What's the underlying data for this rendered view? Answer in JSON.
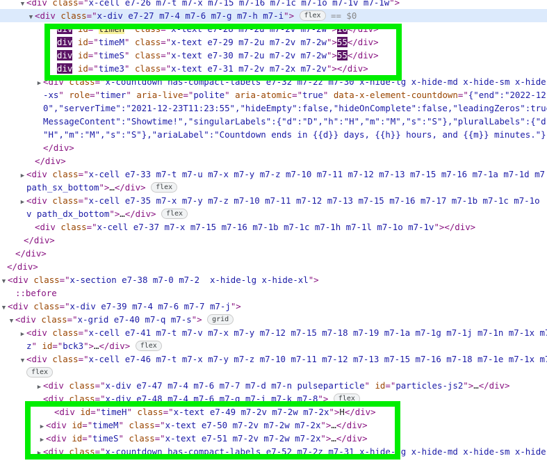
{
  "lines": [
    {
      "indent": 38,
      "tri": "down",
      "segments": [
        {
          "k": "tag",
          "t": "<div "
        },
        {
          "k": "an",
          "t": "class"
        },
        {
          "k": "tag",
          "t": "=\""
        },
        {
          "k": "av",
          "t": "x-cell e7-26 m7-t m7-x m7-15 m7-16 m7-1c m7-1o m7-1v m7-1w"
        },
        {
          "k": "tag",
          "t": "\">"
        }
      ]
    },
    {
      "indent": 50,
      "tri": "down",
      "sel": true,
      "segments": [
        {
          "k": "tag",
          "t": "<div "
        },
        {
          "k": "an",
          "t": "class"
        },
        {
          "k": "tag",
          "t": "=\""
        },
        {
          "k": "av",
          "t": "x-div e7-27 m7-4 m7-6 m7-g m7-h m7-i"
        },
        {
          "k": "tag",
          "t": "\">"
        },
        {
          "k": "sp",
          "t": " "
        },
        {
          "k": "badge",
          "t": "flex"
        },
        {
          "k": "eq",
          "t": " == $0"
        }
      ]
    },
    {
      "indent": 82,
      "segments": [
        {
          "k": "invtag",
          "t": "div"
        },
        {
          "k": "sp",
          "t": " "
        },
        {
          "k": "an",
          "t": "id"
        },
        {
          "k": "tag",
          "t": "=\""
        },
        {
          "k": "hlid",
          "t": "timeH"
        },
        {
          "k": "tag",
          "t": "\" "
        },
        {
          "k": "an",
          "t": "class"
        },
        {
          "k": "tag",
          "t": "=\""
        },
        {
          "k": "av",
          "t": "x-text e7-28 m7-2u m7-2v m7-2w"
        },
        {
          "k": "tag",
          "t": "\">"
        },
        {
          "k": "invval",
          "t": "16"
        },
        {
          "k": "tag",
          "t": "</div>"
        }
      ]
    },
    {
      "indent": 82,
      "segments": [
        {
          "k": "invtag",
          "t": "div"
        },
        {
          "k": "sp",
          "t": " "
        },
        {
          "k": "an",
          "t": "id"
        },
        {
          "k": "tag",
          "t": "=\""
        },
        {
          "k": "av",
          "t": "timeM"
        },
        {
          "k": "tag",
          "t": "\" "
        },
        {
          "k": "an",
          "t": "class"
        },
        {
          "k": "tag",
          "t": "=\""
        },
        {
          "k": "av",
          "t": "x-text e7-29 m7-2u m7-2v m7-2w"
        },
        {
          "k": "tag",
          "t": "\">"
        },
        {
          "k": "invval",
          "t": "55"
        },
        {
          "k": "tag",
          "t": "</div>"
        }
      ]
    },
    {
      "indent": 82,
      "segments": [
        {
          "k": "invtag",
          "t": "div"
        },
        {
          "k": "sp",
          "t": " "
        },
        {
          "k": "an",
          "t": "id"
        },
        {
          "k": "tag",
          "t": "=\""
        },
        {
          "k": "av",
          "t": "timeS"
        },
        {
          "k": "tag",
          "t": "\" "
        },
        {
          "k": "an",
          "t": "class"
        },
        {
          "k": "tag",
          "t": "=\""
        },
        {
          "k": "av",
          "t": "x-text e7-30 m7-2u m7-2v m7-2w"
        },
        {
          "k": "tag",
          "t": "\">"
        },
        {
          "k": "invval",
          "t": "55"
        },
        {
          "k": "tag",
          "t": "</div>"
        }
      ]
    },
    {
      "indent": 82,
      "segments": [
        {
          "k": "invtag",
          "t": "div"
        },
        {
          "k": "sp",
          "t": " "
        },
        {
          "k": "an",
          "t": "id"
        },
        {
          "k": "tag",
          "t": "=\""
        },
        {
          "k": "av",
          "t": "time3"
        },
        {
          "k": "tag",
          "t": "\" "
        },
        {
          "k": "an",
          "t": "class"
        },
        {
          "k": "tag",
          "t": "=\""
        },
        {
          "k": "av",
          "t": "x-text e7-31 m7-2v m7-2x m7-2v"
        },
        {
          "k": "tag",
          "t": "\">"
        },
        {
          "k": "tag",
          "t": "</div>"
        }
      ]
    },
    {
      "indent": 62,
      "tri": "right",
      "segments": [
        {
          "k": "tag",
          "t": "<div "
        },
        {
          "k": "an",
          "t": "class"
        },
        {
          "k": "tag",
          "t": "=\""
        },
        {
          "k": "av",
          "t": "x-countdown has-compact-labels e7-32 m7-2z m7-30 x-hide-lg x-hide-md x-hide-sm x-hide"
        }
      ]
    },
    {
      "indent": 62,
      "segments": [
        {
          "k": "av",
          "t": "-xs"
        },
        {
          "k": "tag",
          "t": "\" "
        },
        {
          "k": "an",
          "t": "role"
        },
        {
          "k": "tag",
          "t": "=\""
        },
        {
          "k": "av",
          "t": "timer"
        },
        {
          "k": "tag",
          "t": "\" "
        },
        {
          "k": "an",
          "t": "aria-live"
        },
        {
          "k": "tag",
          "t": "=\""
        },
        {
          "k": "av",
          "t": "polite"
        },
        {
          "k": "tag",
          "t": "\" "
        },
        {
          "k": "an",
          "t": "aria-atomic"
        },
        {
          "k": "tag",
          "t": "=\""
        },
        {
          "k": "av",
          "t": "true"
        },
        {
          "k": "tag",
          "t": "\" "
        },
        {
          "k": "an",
          "t": "data-x-element-countdown"
        },
        {
          "k": "tag",
          "t": "=\""
        },
        {
          "k": "av",
          "t": "{\"end\":\"2022-12-"
        }
      ]
    },
    {
      "indent": 62,
      "segments": [
        {
          "k": "av",
          "t": "0\",\"serverTime\":\"2021-12-23T11:23:55\",\"hideEmpty\":false,\"hideOnComplete\":false,\"leadingZeros\":true"
        }
      ]
    },
    {
      "indent": 62,
      "segments": [
        {
          "k": "av",
          "t": "MessageContent\":\"Showtime!\",\"singularLabels\":{\"d\":\"D\",\"h\":\"H\",\"m\":\"M\",\"s\":\"S\"},\"pluralLabels\":{\"d\""
        }
      ]
    },
    {
      "indent": 62,
      "segments": [
        {
          "k": "av",
          "t": "\"H\",\"m\":\"M\",\"s\":\"S\"},\"ariaLabel\":\"Countdown ends in {{d}} days, {{h}} hours, and {{m}} minutes.\"}"
        }
      ]
    },
    {
      "indent": 62,
      "segments": [
        {
          "k": "tag",
          "t": "</div>"
        }
      ]
    },
    {
      "indent": 50,
      "segments": [
        {
          "k": "tag",
          "t": "</div>"
        }
      ]
    },
    {
      "indent": 38,
      "tri": "right",
      "segments": [
        {
          "k": "tag",
          "t": "<div "
        },
        {
          "k": "an",
          "t": "class"
        },
        {
          "k": "tag",
          "t": "=\""
        },
        {
          "k": "av",
          "t": "x-cell e7-33 m7-t m7-u m7-x m7-y m7-z m7-10 m7-11 m7-12 m7-13 m7-15 m7-16 m7-1a m7-1d m7"
        }
      ]
    },
    {
      "indent": 38,
      "segments": [
        {
          "k": "av",
          "t": "path_sx_bottom"
        },
        {
          "k": "tag",
          "t": "\">"
        },
        {
          "k": "txt",
          "t": "…"
        },
        {
          "k": "tag",
          "t": "</div>"
        },
        {
          "k": "sp",
          "t": " "
        },
        {
          "k": "badge",
          "t": "flex"
        }
      ]
    },
    {
      "indent": 38,
      "tri": "right",
      "segments": [
        {
          "k": "tag",
          "t": "<div "
        },
        {
          "k": "an",
          "t": "class"
        },
        {
          "k": "tag",
          "t": "=\""
        },
        {
          "k": "av",
          "t": "x-cell e7-35 m7-x m7-y m7-z m7-10 m7-11 m7-12 m7-13 m7-15 m7-16 m7-17 m7-1b m7-1c m7-1o"
        }
      ]
    },
    {
      "indent": 38,
      "segments": [
        {
          "k": "av",
          "t": "v path_dx_bottom"
        },
        {
          "k": "tag",
          "t": "\">"
        },
        {
          "k": "txt",
          "t": "…"
        },
        {
          "k": "tag",
          "t": "</div>"
        },
        {
          "k": "sp",
          "t": " "
        },
        {
          "k": "badge",
          "t": "flex"
        }
      ]
    },
    {
      "indent": 50,
      "segments": [
        {
          "k": "tag",
          "t": "<div "
        },
        {
          "k": "an",
          "t": "class"
        },
        {
          "k": "tag",
          "t": "=\""
        },
        {
          "k": "av",
          "t": "x-cell e7-37 m7-x m7-15 m7-16 m7-1b m7-1c m7-1h m7-1l m7-1o m7-1v"
        },
        {
          "k": "tag",
          "t": "\"></div>"
        }
      ]
    },
    {
      "indent": 34,
      "segments": [
        {
          "k": "tag",
          "t": "</div>"
        }
      ]
    },
    {
      "indent": 22,
      "segments": [
        {
          "k": "tag",
          "t": "</div>"
        }
      ]
    },
    {
      "indent": 10,
      "segments": [
        {
          "k": "tag",
          "t": "</div>"
        }
      ]
    },
    {
      "indent": 4,
      "tri": "down",
      "segments": [
        {
          "k": "tag",
          "t": "<div "
        },
        {
          "k": "an",
          "t": "class"
        },
        {
          "k": "tag",
          "t": "=\""
        },
        {
          "k": "av",
          "t": "x-section e7-38 m7-0 m7-2  x-hide-lg x-hide-xl"
        },
        {
          "k": "tag",
          "t": "\">"
        }
      ]
    },
    {
      "indent": 22,
      "segments": [
        {
          "k": "pseudo",
          "t": "::before"
        }
      ]
    },
    {
      "indent": 10,
      "tri": "down",
      "segments": [
        {
          "k": "tag",
          "t": "<div "
        },
        {
          "k": "an",
          "t": "class"
        },
        {
          "k": "tag",
          "t": "=\""
        },
        {
          "k": "av",
          "t": "x-div e7-39 m7-4 m7-6 m7-7 m7-j"
        },
        {
          "k": "tag",
          "t": "\">"
        }
      ]
    },
    {
      "indent": 22,
      "tri": "down",
      "segments": [
        {
          "k": "tag",
          "t": "<div "
        },
        {
          "k": "an",
          "t": "class"
        },
        {
          "k": "tag",
          "t": "=\""
        },
        {
          "k": "av",
          "t": "x-grid e7-40 m7-q m7-s"
        },
        {
          "k": "tag",
          "t": "\">"
        },
        {
          "k": "sp",
          "t": " "
        },
        {
          "k": "badge",
          "t": "grid"
        }
      ]
    },
    {
      "indent": 38,
      "tri": "right",
      "segments": [
        {
          "k": "tag",
          "t": "<div "
        },
        {
          "k": "an",
          "t": "class"
        },
        {
          "k": "tag",
          "t": "=\""
        },
        {
          "k": "av",
          "t": "x-cell e7-41 m7-t m7-v m7-x m7-y m7-12 m7-15 m7-18 m7-19 m7-1a m7-1g m7-1j m7-1n m7-1x m7"
        }
      ]
    },
    {
      "indent": 38,
      "segments": [
        {
          "k": "av",
          "t": "z"
        },
        {
          "k": "tag",
          "t": "\" "
        },
        {
          "k": "an",
          "t": "id"
        },
        {
          "k": "tag",
          "t": "=\""
        },
        {
          "k": "av",
          "t": "bck3"
        },
        {
          "k": "tag",
          "t": "\">"
        },
        {
          "k": "txt",
          "t": "…"
        },
        {
          "k": "tag",
          "t": "</div>"
        },
        {
          "k": "sp",
          "t": " "
        },
        {
          "k": "badge",
          "t": "flex"
        }
      ]
    },
    {
      "indent": 38,
      "tri": "down",
      "segments": [
        {
          "k": "tag",
          "t": "<div "
        },
        {
          "k": "an",
          "t": "class"
        },
        {
          "k": "tag",
          "t": "=\""
        },
        {
          "k": "av",
          "t": "x-cell e7-46 m7-t m7-x m7-y m7-z m7-10 m7-11 m7-12 m7-13 m7-15 m7-16 m7-18 m7-1e m7-1x m7"
        }
      ]
    },
    {
      "indent": 38,
      "segments": [
        {
          "k": "badge",
          "t": "flex"
        }
      ]
    },
    {
      "indent": 62,
      "tri": "right",
      "segments": [
        {
          "k": "tag",
          "t": "<div "
        },
        {
          "k": "an",
          "t": "class"
        },
        {
          "k": "tag",
          "t": "=\""
        },
        {
          "k": "av",
          "t": "x-div e7-47 m7-4 m7-6 m7-7 m7-d m7-n pulseparticle"
        },
        {
          "k": "tag",
          "t": "\" "
        },
        {
          "k": "an",
          "t": "id"
        },
        {
          "k": "tag",
          "t": "=\""
        },
        {
          "k": "av",
          "t": "particles-js2"
        },
        {
          "k": "tag",
          "t": "\">"
        },
        {
          "k": "txt",
          "t": "…"
        },
        {
          "k": "tag",
          "t": "</div>"
        }
      ]
    },
    {
      "indent": 62,
      "segments": [
        {
          "k": "tag",
          "t": "<div "
        },
        {
          "k": "an",
          "t": "class"
        },
        {
          "k": "tag",
          "t": "=\""
        },
        {
          "k": "av",
          "t": "x-div e7-48 m7-4 m7-6 m7-g m7-i m7-k m7-8"
        },
        {
          "k": "tag",
          "t": "\">"
        },
        {
          "k": "sp",
          "t": " "
        },
        {
          "k": "badge",
          "t": "flex"
        }
      ]
    },
    {
      "indent": 78,
      "segments": [
        {
          "k": "tag",
          "t": "<div "
        },
        {
          "k": "an",
          "t": "id"
        },
        {
          "k": "tag",
          "t": "=\""
        },
        {
          "k": "av",
          "t": "timeH"
        },
        {
          "k": "tag",
          "t": "\" "
        },
        {
          "k": "an",
          "t": "class"
        },
        {
          "k": "tag",
          "t": "=\""
        },
        {
          "k": "av",
          "t": "x-text e7-49 m7-2v m7-2w m7-2x"
        },
        {
          "k": "tag",
          "t": "\">"
        },
        {
          "k": "txt",
          "t": "H"
        },
        {
          "k": "tag",
          "t": "</div>"
        }
      ]
    },
    {
      "indent": 66,
      "tri": "right",
      "segments": [
        {
          "k": "tag",
          "t": "<div "
        },
        {
          "k": "an",
          "t": "id"
        },
        {
          "k": "tag",
          "t": "=\""
        },
        {
          "k": "av",
          "t": "timeM"
        },
        {
          "k": "tag",
          "t": "\" "
        },
        {
          "k": "an",
          "t": "class"
        },
        {
          "k": "tag",
          "t": "=\""
        },
        {
          "k": "av",
          "t": "x-text e7-50 m7-2v m7-2w m7-2x"
        },
        {
          "k": "tag",
          "t": "\">"
        },
        {
          "k": "txt",
          "t": "…"
        },
        {
          "k": "tag",
          "t": "</div>"
        }
      ]
    },
    {
      "indent": 66,
      "tri": "right",
      "segments": [
        {
          "k": "tag",
          "t": "<div "
        },
        {
          "k": "an",
          "t": "id"
        },
        {
          "k": "tag",
          "t": "=\""
        },
        {
          "k": "av",
          "t": "timeS"
        },
        {
          "k": "tag",
          "t": "\" "
        },
        {
          "k": "an",
          "t": "class"
        },
        {
          "k": "tag",
          "t": "=\""
        },
        {
          "k": "av",
          "t": "x-text e7-51 m7-2v m7-2w m7-2x"
        },
        {
          "k": "tag",
          "t": "\">"
        },
        {
          "k": "txt",
          "t": "…"
        },
        {
          "k": "tag",
          "t": "</div>"
        }
      ]
    },
    {
      "indent": 62,
      "tri": "right",
      "segments": [
        {
          "k": "tag",
          "t": "<div "
        },
        {
          "k": "an",
          "t": "class"
        },
        {
          "k": "tag",
          "t": "=\""
        },
        {
          "k": "av",
          "t": "x-countdown has-compact-labels e7-52 m7-2z m7-31 x-hide-lg x-hide-md x-hide-sm x-hide"
        }
      ]
    }
  ],
  "highlight_color": "#00ee00"
}
